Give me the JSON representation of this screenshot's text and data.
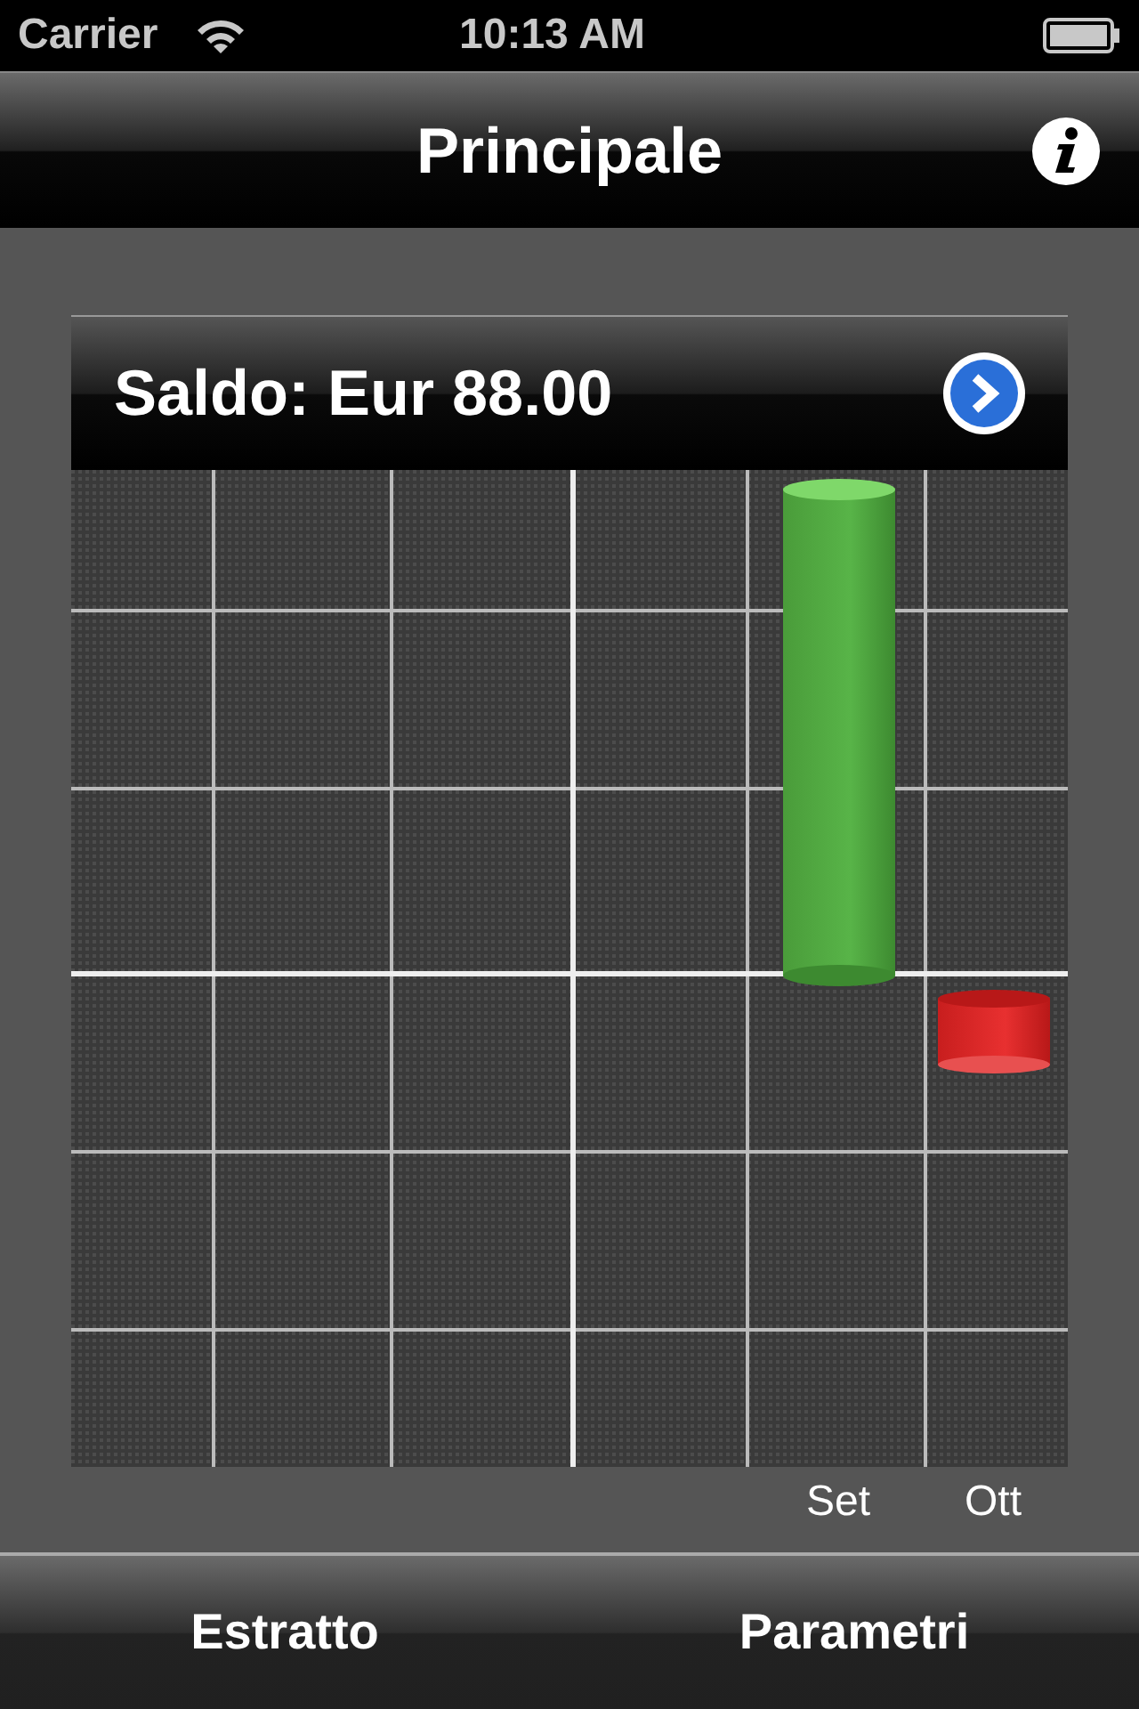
{
  "status_bar": {
    "carrier": "Carrier",
    "time": "10:13 AM"
  },
  "nav_bar": {
    "title": "Principale"
  },
  "balance": {
    "label": "Saldo: Eur 88.00"
  },
  "chart": {
    "labels": [
      "Set",
      "Ott"
    ]
  },
  "tab_bar": {
    "items": [
      {
        "label": "Estratto"
      },
      {
        "label": "Parametri"
      }
    ]
  }
}
